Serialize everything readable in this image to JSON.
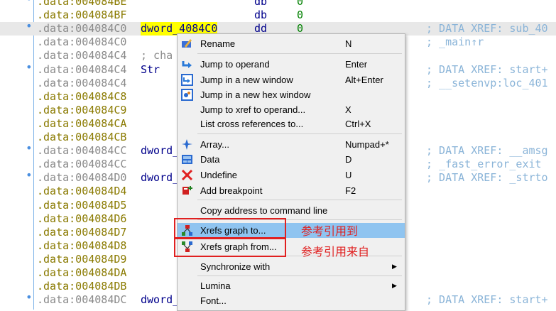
{
  "listing": [
    {
      "dot": true,
      "addr": ".data:004084BE",
      "color": "yellow",
      "name": "",
      "op": "db",
      "val": "0",
      "cmt": ""
    },
    {
      "dot": false,
      "addr": ".data:004084BF",
      "color": "yellow",
      "name": "",
      "op": "db",
      "val": "0",
      "cmt": ""
    },
    {
      "dot": true,
      "addr": ".data:004084C0",
      "color": "grey",
      "name": "dword_4084C0",
      "op": "dd",
      "val": "0",
      "cmt": "; DATA XREF: sub_40"
    },
    {
      "dot": false,
      "addr": ".data:004084C0",
      "color": "grey",
      "name": "",
      "op": "",
      "val": "",
      "cmt": "; _main↑r"
    },
    {
      "dot": false,
      "addr": ".data:004084C4",
      "color": "grey",
      "name": "; cha",
      "op": "",
      "val": "",
      "cmt": ""
    },
    {
      "dot": true,
      "addr": ".data:004084C4",
      "color": "grey",
      "name": "Str",
      "op": "",
      "val": "",
      "cmt": "; DATA XREF: start+"
    },
    {
      "dot": false,
      "addr": ".data:004084C4",
      "color": "grey",
      "name": "",
      "op": "",
      "val": "",
      "cmt": "; __setenvp:loc_401"
    },
    {
      "dot": false,
      "addr": ".data:004084C8",
      "color": "yellow",
      "name": "",
      "op": "",
      "val": "",
      "cmt": ""
    },
    {
      "dot": false,
      "addr": ".data:004084C9",
      "color": "yellow",
      "name": "",
      "op": "",
      "val": "",
      "cmt": ""
    },
    {
      "dot": false,
      "addr": ".data:004084CA",
      "color": "yellow",
      "name": "",
      "op": "",
      "val": "",
      "cmt": ""
    },
    {
      "dot": false,
      "addr": ".data:004084CB",
      "color": "yellow",
      "name": "",
      "op": "",
      "val": "",
      "cmt": ""
    },
    {
      "dot": true,
      "addr": ".data:004084CC",
      "color": "grey",
      "name": "dword_",
      "op": "",
      "val": "",
      "cmt": "; DATA XREF: __amsg"
    },
    {
      "dot": false,
      "addr": ".data:004084CC",
      "color": "grey",
      "name": "",
      "op": "",
      "val": "",
      "cmt": "; _fast_error_exit"
    },
    {
      "dot": true,
      "addr": ".data:004084D0",
      "color": "grey",
      "name": "dword_",
      "op": "",
      "val": "",
      "cmt": "; DATA XREF: _strto"
    },
    {
      "dot": false,
      "addr": ".data:004084D4",
      "color": "yellow",
      "name": "",
      "op": "",
      "val": "",
      "cmt": ""
    },
    {
      "dot": false,
      "addr": ".data:004084D5",
      "color": "yellow",
      "name": "",
      "op": "",
      "val": "",
      "cmt": ""
    },
    {
      "dot": false,
      "addr": ".data:004084D6",
      "color": "yellow",
      "name": "",
      "op": "",
      "val": "",
      "cmt": ""
    },
    {
      "dot": false,
      "addr": ".data:004084D7",
      "color": "yellow",
      "name": "",
      "op": "",
      "val": "",
      "cmt": ""
    },
    {
      "dot": false,
      "addr": ".data:004084D8",
      "color": "yellow",
      "name": "",
      "op": "",
      "val": "",
      "cmt": ""
    },
    {
      "dot": false,
      "addr": ".data:004084D9",
      "color": "yellow",
      "name": "",
      "op": "",
      "val": "",
      "cmt": ""
    },
    {
      "dot": false,
      "addr": ".data:004084DA",
      "color": "yellow",
      "name": "",
      "op": "",
      "val": "",
      "cmt": ""
    },
    {
      "dot": false,
      "addr": ".data:004084DB",
      "color": "yellow",
      "name": "",
      "op": "",
      "val": "",
      "cmt": ""
    },
    {
      "dot": true,
      "addr": ".data:004084DC",
      "color": "grey",
      "name": "dword_",
      "op": "",
      "val": "",
      "cmt": "; DATA XREF: start+"
    }
  ],
  "menu": {
    "items": [
      {
        "label": "Rename",
        "shortcut": "N",
        "icon": "rename-icon"
      },
      {
        "label": "Jump to operand",
        "shortcut": "Enter",
        "icon": "jump-arrow-icon"
      },
      {
        "label": "Jump in a new window",
        "shortcut": "Alt+Enter",
        "icon": "new-window-icon"
      },
      {
        "label": "Jump in a new hex window",
        "shortcut": "",
        "icon": "hex-window-icon"
      },
      {
        "label": "Jump to xref to operand...",
        "shortcut": "X",
        "icon": ""
      },
      {
        "label": "List cross references to...",
        "shortcut": "Ctrl+X",
        "icon": ""
      },
      {
        "label": "Array...",
        "shortcut": "Numpad+*",
        "icon": "array-icon"
      },
      {
        "label": "Data",
        "shortcut": "D",
        "icon": "data-icon"
      },
      {
        "label": "Undefine",
        "shortcut": "U",
        "icon": "undefine-x-icon"
      },
      {
        "label": "Add breakpoint",
        "shortcut": "F2",
        "icon": "breakpoint-icon"
      },
      {
        "label": "Copy address to command line",
        "shortcut": "",
        "icon": ""
      },
      {
        "label": "Xrefs graph to...",
        "shortcut": "",
        "icon": "xrefs-graph-to-icon"
      },
      {
        "label": "Xrefs graph from...",
        "shortcut": "",
        "icon": "xrefs-graph-from-icon"
      },
      {
        "label": "Synchronize with",
        "shortcut": "",
        "icon": "",
        "submenu": true
      },
      {
        "label": "Lumina",
        "shortcut": "",
        "icon": "",
        "submenu": true
      },
      {
        "label": "Font...",
        "shortcut": "",
        "icon": ""
      }
    ]
  },
  "annotations": {
    "xrefs_to": "参考引用到",
    "xrefs_from": "参考引用来自"
  },
  "colors": {
    "highlight_yellow": "#ffff00",
    "menu_hover": "#8fc4f0",
    "annotation_red": "#e02020"
  }
}
